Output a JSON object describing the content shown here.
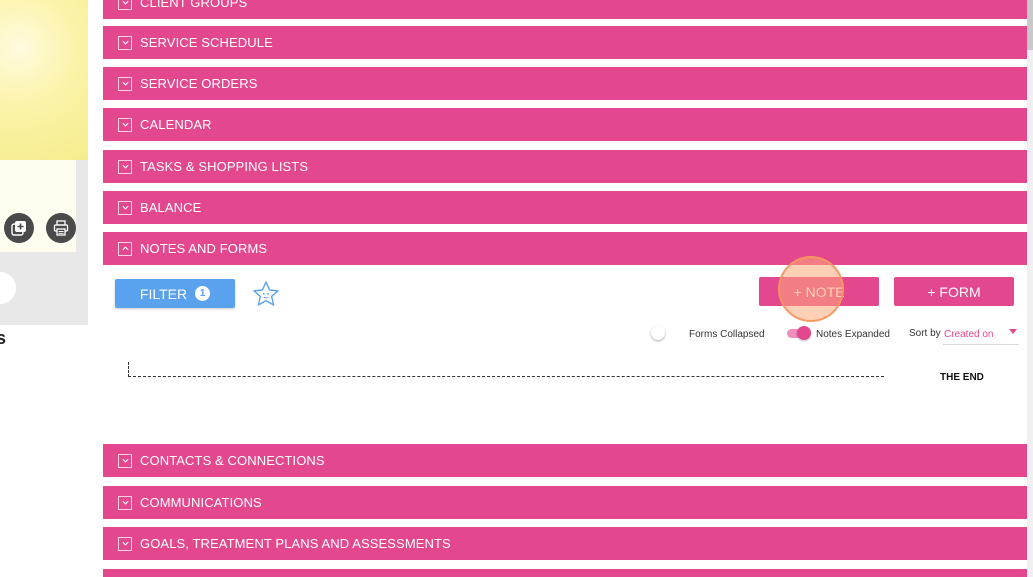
{
  "left_panel": {
    "name_fragment": "s"
  },
  "sections": [
    {
      "label": "CLIENT GROUPS",
      "state": "collapsed"
    },
    {
      "label": "SERVICE SCHEDULE",
      "state": "collapsed"
    },
    {
      "label": "SERVICE ORDERS",
      "state": "collapsed"
    },
    {
      "label": "CALENDAR",
      "state": "collapsed"
    },
    {
      "label": "TASKS & SHOPPING LISTS",
      "state": "collapsed"
    },
    {
      "label": "BALANCE",
      "state": "collapsed"
    },
    {
      "label": "NOTES AND FORMS",
      "state": "expanded"
    },
    {
      "label": "CONTACTS & CONNECTIONS",
      "state": "collapsed"
    },
    {
      "label": "COMMUNICATIONS",
      "state": "collapsed"
    },
    {
      "label": "GOALS, TREATMENT PLANS AND ASSESSMENTS",
      "state": "collapsed"
    }
  ],
  "notes": {
    "filter_label": "FILTER",
    "filter_count": "1",
    "add_note_label": "+ NOTE",
    "add_form_label": "+ FORM",
    "forms_toggle_label": "Forms Collapsed",
    "forms_toggle_on": false,
    "notes_toggle_label": "Notes Expanded",
    "notes_toggle_on": true,
    "sort_label": "Sort by",
    "sort_value": "Created on",
    "end_label": "THE END"
  },
  "colors": {
    "section_bar": "#e3478e",
    "filter_button": "#5aa2ee",
    "accent": "#e3478e"
  }
}
